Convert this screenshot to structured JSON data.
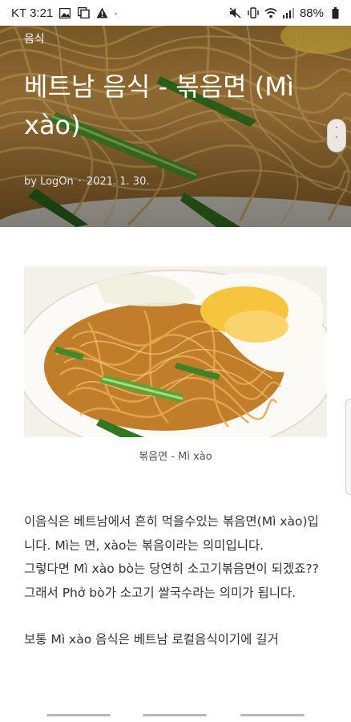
{
  "status_bar": {
    "carrier_time": "KT 3:21",
    "battery": "88%",
    "left_icons": [
      "image-icon",
      "gallery-icon",
      "warning-icon",
      "dot-icon"
    ],
    "right_icons": [
      "mute-icon",
      "vibrate-icon",
      "wifi-icon",
      "signal-icon",
      "battery-icon"
    ]
  },
  "hero": {
    "category": "음식",
    "title": "베트남 음식 - 볶음면 (Mì xào)",
    "author": "by LogOn",
    "separator": "·",
    "date": "2021. 1. 30."
  },
  "scroll_handle": {
    "up": "˄",
    "down": "˅"
  },
  "figure": {
    "image_alt": "볶음면 사진",
    "caption": "볶음면 - Mì xào"
  },
  "article": {
    "paragraph1": "이음식은 베트남에서 흔히 먹을수있는 볶음면(Mì xào)입니다. Mì는 면, xào는 볶음이라는 의미입니다.",
    "paragraph2": "그렇다면 Mì xào bò는 당연히 소고기볶음면이 되겠죠?? 그래서 Phở bò가 소고기 쌀국수라는 의미가 됩니다.",
    "paragraph3": "보통 Mì xào 음식은 베트남 로컬음식이기에 길거"
  },
  "colors": {
    "hero_noodle": "#c8903a",
    "greens": "#3f8a2a",
    "egg": "#f6c23a",
    "text": "#333333"
  }
}
